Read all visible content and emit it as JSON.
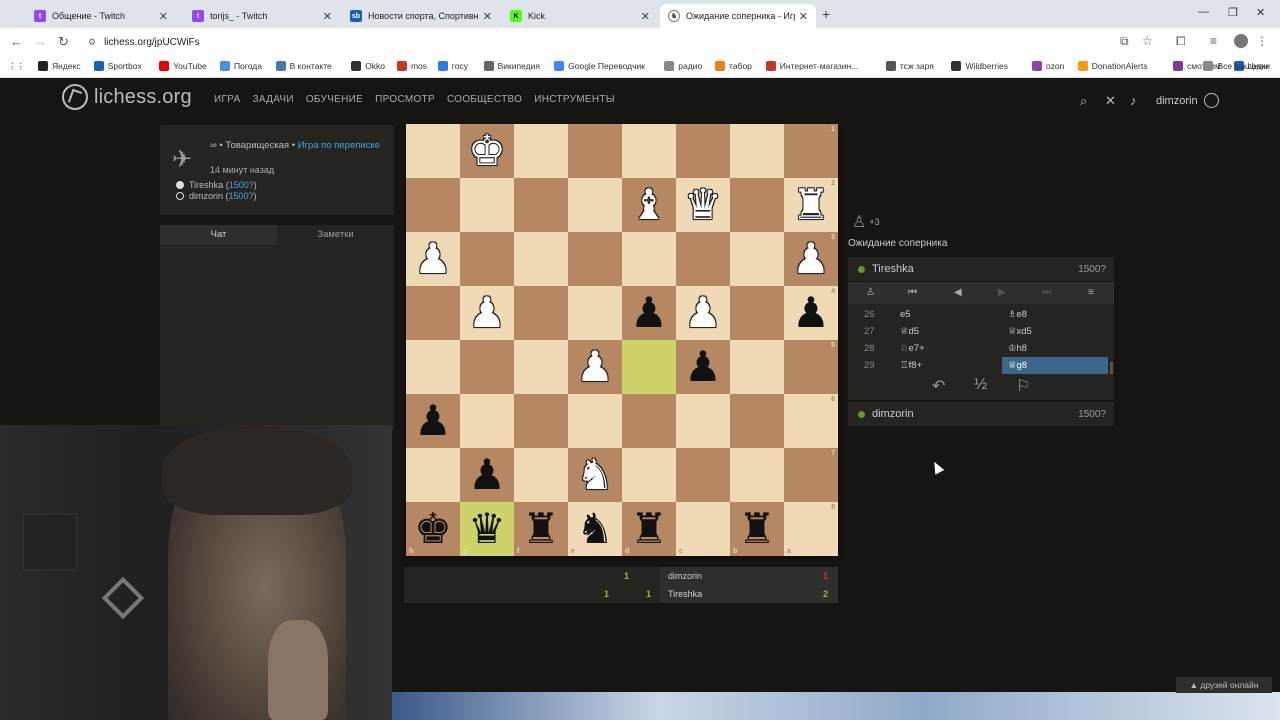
{
  "browser": {
    "tabs": [
      {
        "title": "Общение - Twitch",
        "color": "#9146ff",
        "active": false
      },
      {
        "title": "torijs_ - Twitch",
        "color": "#9146ff",
        "active": false
      },
      {
        "title": "Новости спорта, Спортивная",
        "color": "#1a5fb4",
        "active": false
      },
      {
        "title": "Kick",
        "color": "#53fc18",
        "active": false
      },
      {
        "title": "Ожидание соперника - Игра",
        "color": "#555555",
        "active": true
      }
    ],
    "url": "lichess.org/jpUCWiFs",
    "bookmarks": [
      {
        "label": "Яндекс",
        "color": "#222"
      },
      {
        "label": "Sportbox",
        "color": "#1a5fb4"
      },
      {
        "label": "YouTube",
        "color": "#e00"
      },
      {
        "label": "Погода",
        "color": "#4a90d9"
      },
      {
        "label": "В контакте",
        "color": "#4a76a8"
      },
      {
        "label": "Okko",
        "color": "#333"
      },
      {
        "label": "mos",
        "color": "#c0392b"
      },
      {
        "label": "госу",
        "color": "#2c7be5"
      },
      {
        "label": "Википедия",
        "color": "#666"
      },
      {
        "label": "Google Переводчик",
        "color": "#4285f4"
      },
      {
        "label": "радио",
        "color": "#888"
      },
      {
        "label": "табор",
        "color": "#e67e22"
      },
      {
        "label": "Интернет-магазин...",
        "color": "#c0392b"
      },
      {
        "label": "тсж заря",
        "color": "#555"
      },
      {
        "label": "Wildberries",
        "color": "#333"
      },
      {
        "label": "ozon",
        "color": "#8e44ad"
      },
      {
        "label": "DonationAlerts",
        "color": "#f39c12"
      },
      {
        "label": "смотрим",
        "color": "#7d3c98"
      },
      {
        "label": "Циан",
        "color": "#1a5fb4"
      }
    ],
    "all_bookmarks": "Все закладки"
  },
  "lichess": {
    "logo": "lichess.org",
    "nav": [
      "ИГРА",
      "ЗАДАЧИ",
      "ОБУЧЕНИЕ",
      "ПРОСМОТР",
      "СООБЩЕСТВО",
      "ИНСТРУМЕНТЫ"
    ],
    "username": "dimzorin"
  },
  "game_info": {
    "prefix": "∞ • Товарищеская • ",
    "type_link": "Игра по переписке",
    "ago": "14 минут назад",
    "players": [
      {
        "name": "Tireshka",
        "rating": "1500?",
        "color": "white"
      },
      {
        "name": "dimzorin",
        "rating": "1500?",
        "color": "black"
      }
    ]
  },
  "chat": {
    "tabs": [
      "Чат",
      "Заметки"
    ]
  },
  "board": {
    "orientation": "black",
    "ranks": [
      [
        "",
        "K",
        "",
        "",
        "",
        "",
        "",
        ""
      ],
      [
        "",
        "",
        "",
        "",
        "B",
        "Q",
        "",
        "R"
      ],
      [
        "P",
        "",
        "",
        "",
        "",
        "",
        "",
        "P"
      ],
      [
        "",
        "P",
        "",
        "",
        "p",
        "P",
        "",
        "p"
      ],
      [
        "",
        "",
        "",
        "P",
        "",
        "p",
        "",
        ""
      ],
      [
        "p",
        "",
        "",
        "",
        "",
        "",
        "",
        ""
      ],
      [
        "",
        "p",
        "",
        "N",
        "",
        "",
        "",
        ""
      ],
      [
        "k",
        "q",
        "r",
        "n",
        "r",
        "",
        "r",
        ""
      ]
    ],
    "highlight": [
      [
        4,
        4
      ],
      [
        7,
        1
      ]
    ],
    "rank_labels": [
      "1",
      "2",
      "3",
      "4",
      "5",
      "6",
      "7",
      "8"
    ],
    "file_labels": [
      "h",
      "g",
      "f",
      "e",
      "d",
      "c",
      "b",
      "a"
    ]
  },
  "crosstable": [
    {
      "name": "dimzorin",
      "scores": [
        "",
        "1"
      ],
      "total": "1",
      "total_color": "#cc3333"
    },
    {
      "name": "Tireshka",
      "scores": [
        "1",
        "1"
      ],
      "total": "2",
      "total_color": "#9ab73a"
    }
  ],
  "right_panel": {
    "material": "+3",
    "status": "Ожидание соперника",
    "top_player": {
      "name": "Tireshka",
      "rating": "1500?"
    },
    "bottom_player": {
      "name": "dimzorin",
      "rating": "1500?"
    },
    "moves": [
      {
        "num": "26",
        "white": "e5",
        "black": "♗e8"
      },
      {
        "num": "27",
        "white": "♕d5",
        "black": "♕xd5"
      },
      {
        "num": "28",
        "white": "♘e7+",
        "black": "♔h8"
      },
      {
        "num": "29",
        "white": "♖f8+",
        "black": "♕g8"
      }
    ],
    "half": "½"
  },
  "friends_online": "друзей онлайн",
  "colors": {
    "accent": "#4f9dd8",
    "online": "#629924",
    "light_square": "#f0d9b5",
    "dark_square": "#b58863",
    "highlight": "#cdd26a"
  }
}
